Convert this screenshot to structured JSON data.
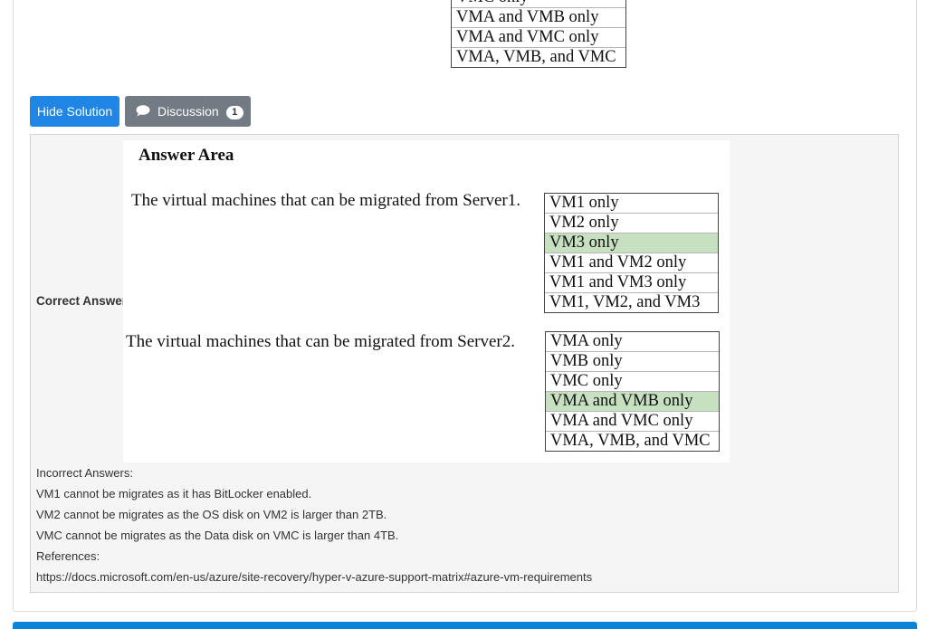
{
  "question": {
    "options": [
      "VMC only",
      "VMA and VMB only",
      "VMA and VMC only",
      "VMA, VMB, and VMC"
    ]
  },
  "buttons": {
    "hide_solution": "Hide Solution",
    "discussion": "Discussion",
    "discussion_count": "1"
  },
  "solution": {
    "correct_label": "Correct Answer:",
    "answer_area": {
      "title": "Answer Area",
      "statement1": "The virtual machines that can be migrated from Server1.",
      "list1": [
        "VM1 only",
        "VM2 only",
        "VM3 only",
        "VM1 and VM2 only",
        "VM1 and VM3 only",
        "VM1, VM2, and VM3"
      ],
      "statement2": "The virtual machines that can be migrated from Server2.",
      "list2": [
        "VMA only",
        "VMB only",
        "VMC only",
        "VMA and VMB only",
        "VMA and VMC only",
        "VMA, VMB, and VMC"
      ],
      "selected_list1": "VM3 only",
      "selected_list2": "VMA and VMB only"
    },
    "explanation": [
      "Incorrect Answers:",
      "VM1 cannot be migrates as it has BitLocker enabled.",
      "VM2 cannot be migrates as the OS disk on VM2 is larger than 2TB.",
      "VMC cannot be migrates as the Data disk on VMC is larger than 4TB.",
      "References:",
      "https://docs.microsoft.com/en-us/azure/site-recovery/hyper-v-azure-support-matrix#azure-vm-requirements"
    ]
  },
  "colors": {
    "primary": "#1f86e6",
    "secondary": "#727b84",
    "selected_option": "#c6e0c0"
  }
}
